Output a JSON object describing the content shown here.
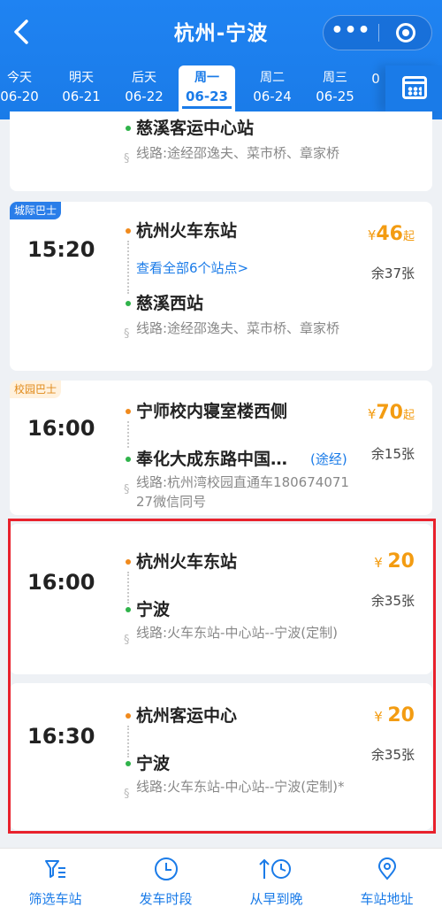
{
  "header": {
    "back_icon": "back-arrow-icon",
    "title": "杭州-宁波",
    "more_label": "•••"
  },
  "dates": [
    {
      "day": "今天",
      "date": "06-20"
    },
    {
      "day": "明天",
      "date": "06-21"
    },
    {
      "day": "后天",
      "date": "06-22"
    },
    {
      "day": "周一",
      "date": "06-23",
      "active": true
    },
    {
      "day": "周二",
      "date": "06-24"
    },
    {
      "day": "周三",
      "date": "06-25"
    },
    {
      "day": "",
      "date": "0"
    }
  ],
  "cards": [
    {
      "arrive": "慈溪客运中心站",
      "route": "线路:途经邵逸夫、菜市桥、章家桥"
    },
    {
      "tag": "城际巴士",
      "time": "15:20",
      "depart": "杭州火车东站",
      "view_all": "查看全部6个站点>",
      "arrive": "慈溪西站",
      "route": "线路:途经邵逸夫、菜市桥、章家桥",
      "price_yen": "¥",
      "price": "46",
      "price_suffix": "起",
      "remaining": "余37张"
    },
    {
      "tag": "校园巴士",
      "time": "16:00",
      "depart": "宁师校内寝室楼西侧",
      "arrive": "奉化大成东路中国…",
      "via": "(途经)",
      "route": "线路:杭州湾校园直通车18067407127微信同号",
      "price_yen": "¥",
      "price": "70",
      "price_suffix": "起",
      "remaining": "余15张"
    },
    {
      "time": "16:00",
      "depart": "杭州火车东站",
      "arrive": "宁波",
      "route": "线路:火车东站-中心站--宁波(定制)",
      "price_yen": "¥",
      "price": "20",
      "remaining": "余35张"
    },
    {
      "time": "16:30",
      "depart": "杭州客运中心",
      "arrive": "宁波",
      "route": "线路:火车东站-中心站--宁波(定制)*",
      "price_yen": "¥",
      "price": "20",
      "remaining": "余35张"
    }
  ],
  "bottom_nav": [
    {
      "label": "筛选车站",
      "icon": "filter-icon"
    },
    {
      "label": "发车时段",
      "icon": "clock-icon"
    },
    {
      "label": "从早到晚",
      "icon": "sort-time-icon"
    },
    {
      "label": "车站地址",
      "icon": "location-pin-icon"
    }
  ],
  "colors": {
    "primary": "#1a7be8",
    "price": "#f39c12",
    "highlight": "#e8212c"
  }
}
